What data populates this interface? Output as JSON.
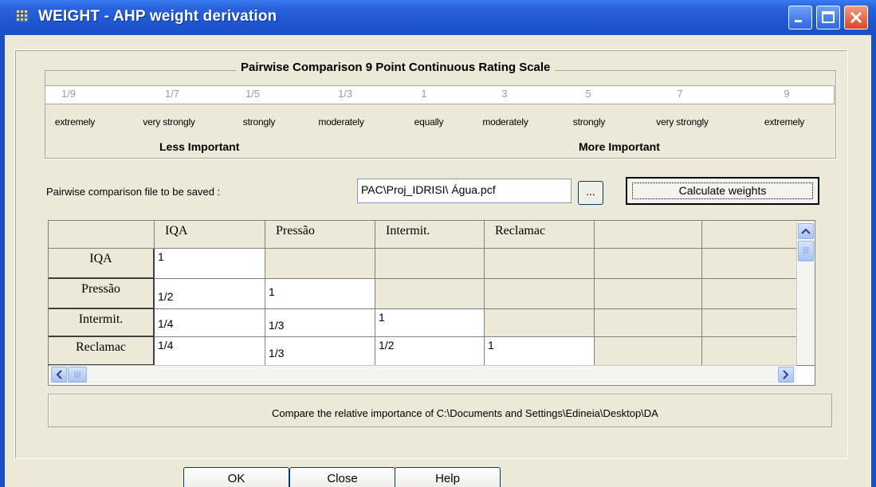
{
  "window": {
    "title": "WEIGHT - AHP weight derivation",
    "titlebar_color": "#1f56d3",
    "controls": [
      "minimize-icon",
      "maximize-icon",
      "close-icon"
    ]
  },
  "scale": {
    "title": "Pairwise Comparison 9 Point Continuous Rating Scale",
    "values": [
      "1/9",
      "1/7",
      "1/5",
      "1/3",
      "1",
      "3",
      "5",
      "7",
      "9"
    ],
    "words": [
      "extremely",
      "very strongly",
      "strongly",
      "moderately",
      "equally",
      "moderately",
      "strongly",
      "very strongly",
      "extremely"
    ],
    "less_label": "Less Important",
    "more_label": "More Important"
  },
  "file": {
    "label": "Pairwise comparison file to be saved :",
    "value": "PAC\\Proj_IDRISI\\ Água.pcf",
    "browse_label": "...",
    "calculate_label": "Calculate weights"
  },
  "grid": {
    "columns": [
      "IQA",
      "Pressão",
      "Intermit.",
      "Reclamac"
    ],
    "rows": [
      {
        "label": "IQA",
        "cells": [
          "1",
          "",
          "",
          ""
        ]
      },
      {
        "label": "Pressão",
        "cells": [
          "1/2",
          "1",
          "",
          ""
        ]
      },
      {
        "label": "Intermit.",
        "cells": [
          "1/4",
          "1/3",
          "1",
          ""
        ]
      },
      {
        "label": "Reclamac",
        "cells": [
          "1/4",
          "1/3",
          "1/2",
          "1"
        ]
      }
    ]
  },
  "status": {
    "text": "Compare the relative importance of C:\\Documents and Settings\\Edineia\\Desktop\\DA"
  },
  "buttons": {
    "ok": "OK",
    "close": "Close",
    "help": "Help"
  }
}
